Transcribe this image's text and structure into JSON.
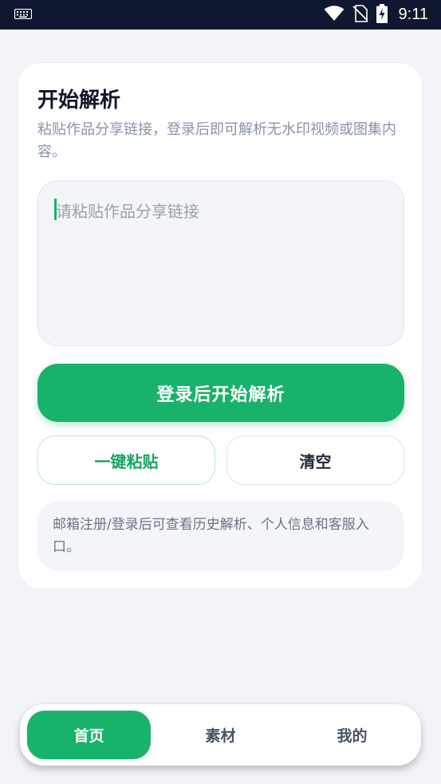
{
  "status_bar": {
    "time": "9:11",
    "icons": [
      "keyboard-icon",
      "wifi-icon",
      "no-sim-icon",
      "battery-charging-icon"
    ]
  },
  "card": {
    "title": "开始解析",
    "subtitle": "粘贴作品分享链接，登录后即可解析无水印视频或图集内容。",
    "input_placeholder": "请粘贴作品分享链接",
    "primary_button": "登录后开始解析",
    "paste_button": "一键粘贴",
    "clear_button": "清空",
    "notice": "邮箱注册/登录后可查看历史解析、个人信息和客服入口。"
  },
  "tabs": {
    "active": "首页",
    "items": [
      {
        "label": "首页"
      },
      {
        "label": "素材"
      },
      {
        "label": "我的"
      }
    ]
  },
  "colors": {
    "accent": "#19b26b",
    "status_bar_bg": "#0f1830",
    "page_bg": "#f3f4f8"
  }
}
